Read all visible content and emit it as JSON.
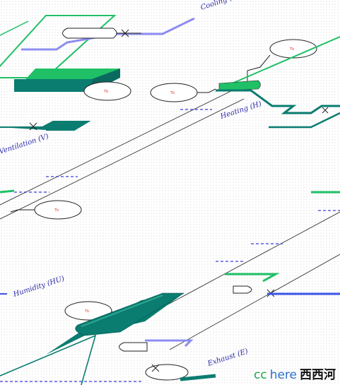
{
  "diagram": {
    "labels": [
      "Cooling (C)",
      "Heating (H)",
      "Ventilation (V)",
      "Humidity (HU)",
      "Exhaust (E)"
    ],
    "valve_tags": [
      "Tb",
      "Tb",
      "Tb",
      "Tb"
    ],
    "colors": {
      "green": "#1fc066",
      "teal": "#0a7c70",
      "blue": "#3c55e6",
      "lavender": "#8c8cf2",
      "dash": "#3a3ae0",
      "valve_text": "#e04040"
    }
  },
  "watermark": {
    "brand_cc": "cc",
    "brand_here": "here",
    "brand_cn": "西西河"
  }
}
